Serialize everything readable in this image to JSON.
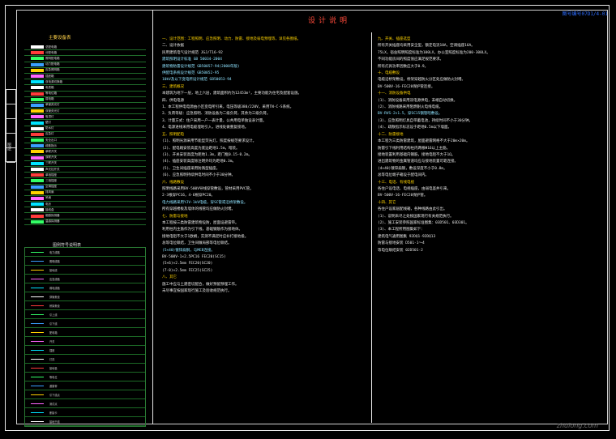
{
  "drawing_tag": "图号编号07D1/4-01",
  "doc_title": "设计说明",
  "binding_strip_label": "图纸",
  "legend": {
    "title": "主要设备表",
    "rows": [
      "总配电箱",
      "分配电箱",
      "照明配电箱",
      "动力配电箱",
      "应急照明箱",
      "插座箱",
      "双电源切换箱",
      "电表箱",
      "等电位箱",
      "弱电箱",
      "单管荧光灯",
      "双管荧光灯",
      "吸顶灯",
      "壁灯",
      "防水灯",
      "应急灯",
      "安全出口",
      "疏散指示",
      "单联开关",
      "双联开关",
      "三联开关",
      "声光控开关",
      "单相插座",
      "三相插座",
      "空调插座",
      "排风扇",
      "吊扇",
      "电铃",
      "接线盒",
      "烟感探测器",
      "温感探测器"
    ]
  },
  "legend2": {
    "title": "图例符号说明表",
    "rows": [
      "电力线路",
      "照明线路",
      "接地线",
      "应急线路",
      "弱电线路",
      "穿管敷设",
      "桥架敷设",
      "引上线",
      "引下线",
      "配电箱",
      "开关",
      "插座",
      "灯具",
      "接地极",
      "等电位",
      "避雷带",
      "引下线点",
      "测试点",
      "断接卡",
      "接地干线"
    ]
  },
  "middle_column": [
    {
      "cls": "h",
      "text": "一、设计范围：工程照明、应急照明、动力、防雷、接地及弱电预埋等，详见各图纸。"
    },
    {
      "cls": "t",
      "text": "二、设计依据"
    },
    {
      "cls": "t",
      "text": "    民用建筑电气设计规范 JGJ/T16-92"
    },
    {
      "cls": "i",
      "text": "    建筑照明设计标准 GB 50034-2004"
    },
    {
      "cls": "i",
      "text": "    建筑物防雷设计规范 GB50057-94(2000年版)"
    },
    {
      "cls": "i",
      "text": "    供配电系统设计规范 GB50052-95"
    },
    {
      "cls": "i",
      "text": "    10kV及以下变电所设计规范 GB50053-94"
    },
    {
      "cls": "h",
      "text": "三、建筑概况"
    },
    {
      "cls": "t",
      "text": "    本建筑为地下一层，地上六层，建筑面积约为12453m²，主要功能为住宅及配套设施。"
    },
    {
      "cls": "t",
      "text": "四、供电电源"
    },
    {
      "cls": "t",
      "text": "    1、本工程供电电源由小区变电所引来，电压等级380/220V，采用TN-C-S系统。"
    },
    {
      "cls": "t",
      "text": "    2、负荷等级：应急照明、消防设备为二级负荷，其余为三级负荷。"
    },
    {
      "cls": "t",
      "text": "    3、计量方式：住户采用一户一表计量，公共用电单独设表计量。"
    },
    {
      "cls": "t",
      "text": "    4、电源进线采用电缆埋地引入，进线处做重复接地。"
    },
    {
      "cls": "h",
      "text": "五、照明配电"
    },
    {
      "cls": "t",
      "text": "    (1)、照明光源采用节能型荧光灯，照度按规范要求设计。"
    },
    {
      "cls": "t",
      "text": "    (2)、配电箱安装高度为底边距地1.5m，暗装。"
    },
    {
      "cls": "t",
      "text": "    (3)、开关安装高度为距地1.3m，距门框0.15-0.2m。"
    },
    {
      "cls": "t",
      "text": "    (4)、插座安装高度除注明外均为距地0.3m。"
    },
    {
      "cls": "t",
      "text": "    (5)、卫生间插座采用防溅型插座。"
    },
    {
      "cls": "t",
      "text": "    (6)、应急照明持续供电时间不小于30分钟。"
    },
    {
      "cls": "h",
      "text": "六、线路敷设"
    },
    {
      "cls": "t",
      "text": "    照明线路采用BV-500V导线穿管敷设，管材采用PVC管。"
    },
    {
      "cls": "t",
      "text": "    2-3根穿PC16，4-6根穿PC20。"
    },
    {
      "cls": "i",
      "text": "    电力线路采用YJV-1kV电缆，穿SC管或沿桥架敷设。"
    },
    {
      "cls": "t",
      "text": "    所有穿越楼板及墙体的线管均应做防火封堵。"
    },
    {
      "cls": "h",
      "text": "七、防雷与接地"
    },
    {
      "cls": "t",
      "text": "    本工程按三类防雷建筑物设防，屋面设避雷带。"
    },
    {
      "cls": "t",
      "text": "    利用柱内主筋作为引下线，基础钢筋作为接地体。"
    },
    {
      "cls": "t",
      "text": "    接地电阻不大于1欧姆，实测不满足时应补打接地极。"
    },
    {
      "cls": "t",
      "text": "    总等电位联结，卫生间做局部等电位联结。"
    },
    {
      "cls": "i",
      "text": "    (5×40)镀锌扁钢，与MEB连接。"
    },
    {
      "cls": "t",
      "text": "    BV-500V-1×2.5PC16  FEC20(SC15)"
    },
    {
      "cls": "t",
      "text": "    (5×6)×2.5mm  FEC20(SC20)"
    },
    {
      "cls": "t",
      "text": "    (7-8)×2.5mm  FEC25(SC25)"
    },
    {
      "cls": "h",
      "text": "八、其它"
    },
    {
      "cls": "t",
      "text": "    施工中应与土建密切配合，做好预留预埋工作。"
    },
    {
      "cls": "t",
      "text": "    未尽事宜按国家现行施工及验收规范执行。"
    }
  ],
  "right_column": [
    {
      "cls": "h",
      "text": "九、开关、插座选型"
    },
    {
      "cls": "t",
      "text": "    所有开关插座均采用安全型，额定电流10A，空调插座16A。"
    },
    {
      "cls": "t",
      "text": "    75LX，宿舍照明照度标准为100LX，办公室照度标准为200-300LX。"
    },
    {
      "cls": "t",
      "text": "    不同功能房间的照度值应满足规范要求。"
    },
    {
      "cls": "t",
      "text": "    所有灯具功率因数应大于0.9。"
    },
    {
      "cls": "h",
      "text": "十、电缆敷设"
    },
    {
      "cls": "t",
      "text": "    电缆沿桥架敷设，桥架穿越防火分区处应做防火封堵。"
    },
    {
      "cls": "t",
      "text": "    BV-500V-16-FEC20保护管连接。"
    },
    {
      "cls": "h",
      "text": "十一、消防设备供电"
    },
    {
      "cls": "t",
      "text": "    (1)、消防设备采用双电源供电，末端自动切换。"
    },
    {
      "cls": "t",
      "text": "    (2)、消防线路采用阻燃耐火电线电缆。"
    },
    {
      "cls": "i",
      "text": "    BV-RVS-2×1.5，穿SC15钢管暗敷设。"
    },
    {
      "cls": "t",
      "text": "    (3)、应急照明灯具自带蓄电池，持续时间不小于30分钟。"
    },
    {
      "cls": "t",
      "text": "    (4)、疏散指示标志设于距地0.5m以下墙面。"
    },
    {
      "cls": "h",
      "text": "十二、防雷接地"
    },
    {
      "cls": "t",
      "text": "    本工程为三类防雷建筑，屋面避雷网格不大于20m×20m。"
    },
    {
      "cls": "t",
      "text": "    防雷引下线利用结构柱内两根Φ16以上主筋。"
    },
    {
      "cls": "t",
      "text": "    接地装置利用基础内钢筋，接地电阻不大于1Ω。"
    },
    {
      "cls": "t",
      "text": "    进出建筑物的金属管道均应与接地装置可靠连接。"
    },
    {
      "cls": "t",
      "text": "    (4×40)镀锌扁钢，敷设深度不小于0.8m。"
    },
    {
      "cls": "t",
      "text": "    总等电位端子箱设于配电间内。"
    },
    {
      "cls": "h",
      "text": "十三、电话、有线电视"
    },
    {
      "cls": "t",
      "text": "    各住户设电话、电视插座，由弱电竖井引来。"
    },
    {
      "cls": "t",
      "text": "    BV-500V-16-FEC20保护管。"
    },
    {
      "cls": "h",
      "text": "十四、其它"
    },
    {
      "cls": "t",
      "text": "    各住户设家居配线箱，各种线路由此引出。"
    },
    {
      "cls": "t",
      "text": "    (1)、说明未尽之处按国家现行有关规范执行。"
    },
    {
      "cls": "t",
      "text": "    (2)、施工安装参照国家标准图集：03D501、03D301。"
    },
    {
      "cls": "t",
      "text": "    (3)、本工程所用图集如下："
    },
    {
      "cls": "t",
      "text": "        建筑电气通用图集 92DQ1-92DQ13"
    },
    {
      "cls": "t",
      "text": "        防雷与接地安装 D501-1～4"
    },
    {
      "cls": "t",
      "text": "        等电位联结安装 02D501-2"
    }
  ],
  "watermark": "zhulong.com"
}
